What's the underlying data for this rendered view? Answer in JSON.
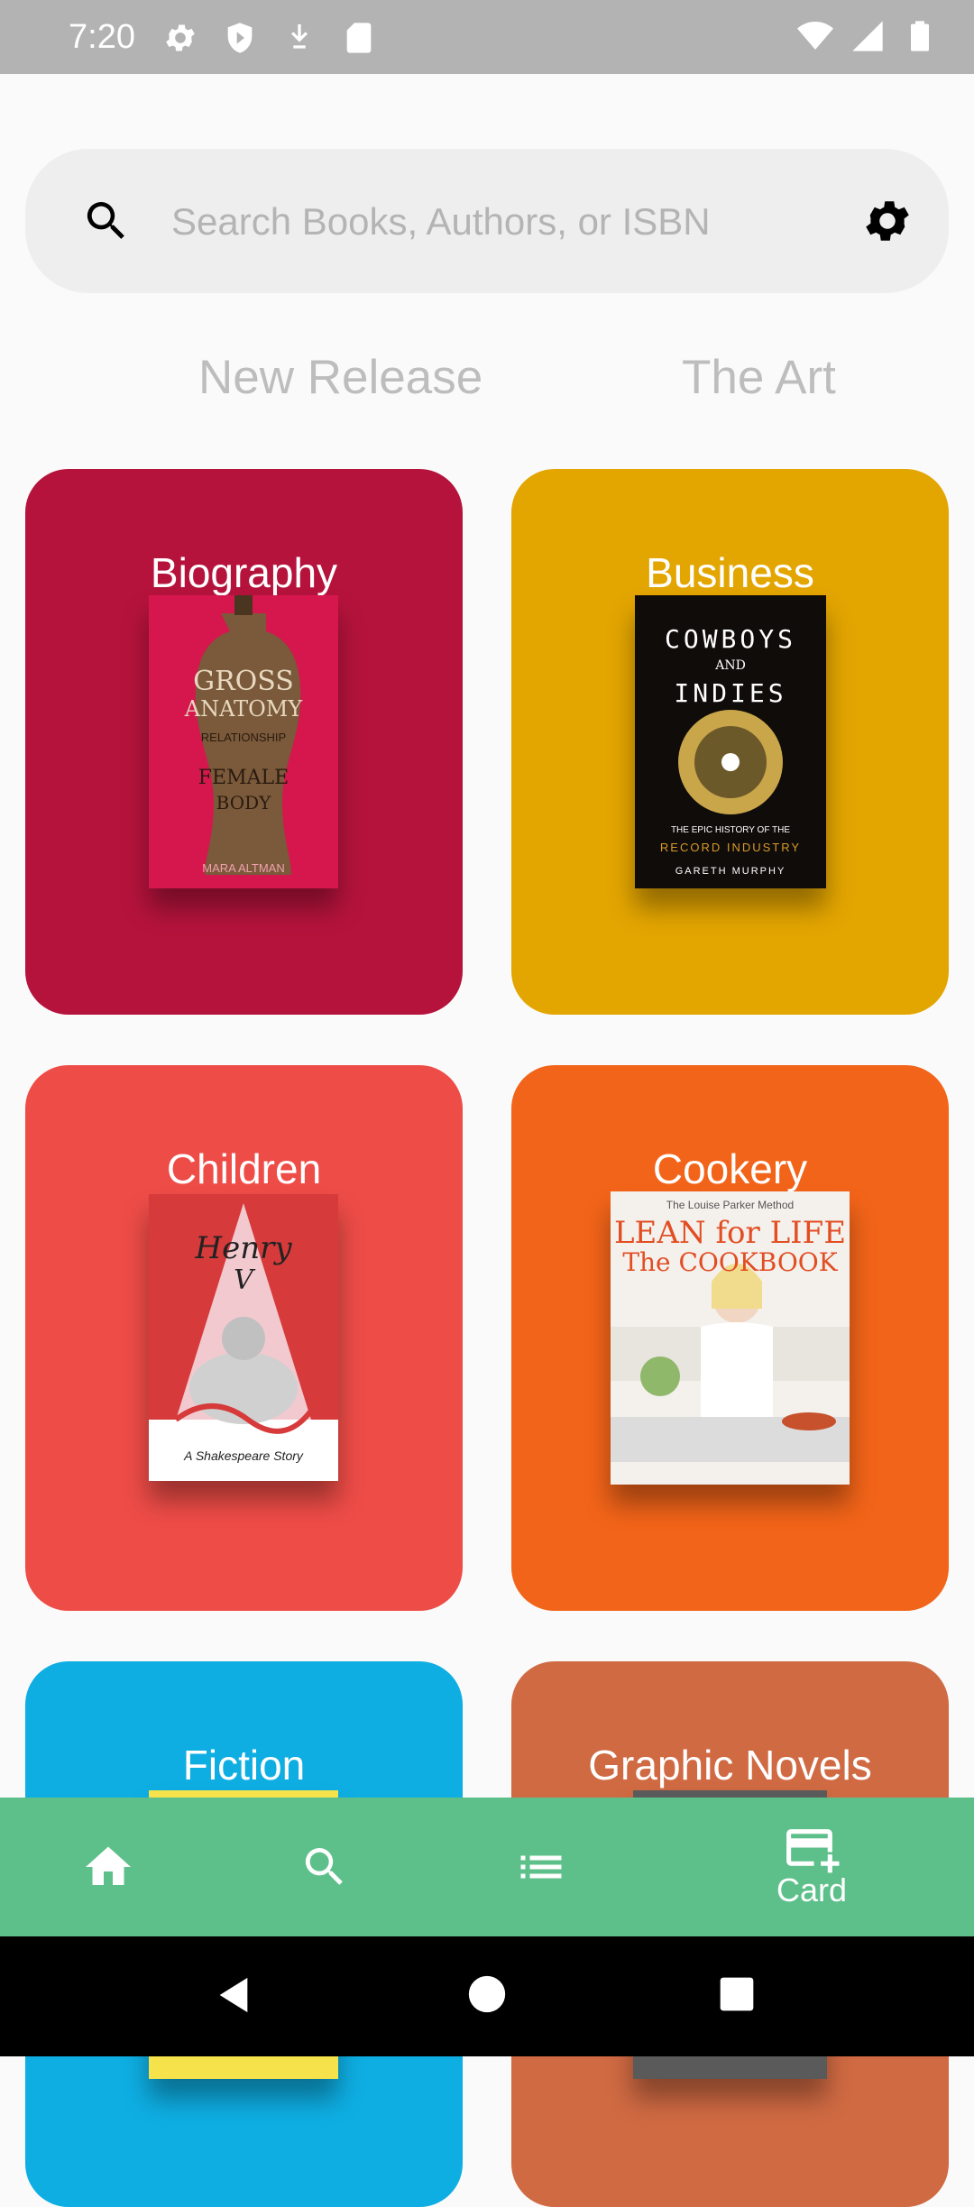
{
  "status_bar": {
    "time": "7:20",
    "left_icons": [
      "settings-icon",
      "shield-icon",
      "download-icon",
      "sd-card-icon"
    ],
    "right_icons": [
      "wifi-icon",
      "signal-icon",
      "battery-icon"
    ]
  },
  "search": {
    "placeholder": "Search Books, Authors, or ISBN",
    "value": ""
  },
  "tabs": [
    {
      "label": "New Release"
    },
    {
      "label": "The Art"
    }
  ],
  "categories": [
    {
      "title": "Biography",
      "color": "#b5133c",
      "book": {
        "title_line1": "GROSS",
        "title_line2": "ANATOMY",
        "subtitle": "RELATIONSHIP",
        "subtitle2": "FEMALE",
        "subtitle3": "BODY",
        "author": "MARA ALTMAN"
      }
    },
    {
      "title": "Business",
      "color": "#e3a500",
      "book": {
        "title_line1": "COWBOYS",
        "title_line2": "AND",
        "subtitle": "INDIES",
        "subtitle2": "THE EPIC HISTORY OF THE",
        "subtitle3": "RECORD INDUSTRY",
        "author": "GARETH MURPHY"
      }
    },
    {
      "title": "Children",
      "color": "#ee4c47",
      "book": {
        "title_line1": "Henry",
        "title_line2": "V",
        "subtitle": "A Shakespeare Story",
        "author": ""
      }
    },
    {
      "title": "Cookery",
      "color": "#f26419",
      "book": {
        "title_line1": "LEAN for LIFE",
        "title_line2": "The COOKBOOK",
        "subtitle": "The Louise Parker Method",
        "author": ""
      }
    },
    {
      "title": "Fiction",
      "color": "#0eaee3"
    },
    {
      "title": "Graphic Novels",
      "color": "#d06a43"
    }
  ],
  "bottom_nav": {
    "items": [
      {
        "icon": "home-icon",
        "label": ""
      },
      {
        "icon": "search-icon",
        "label": ""
      },
      {
        "icon": "list-icon",
        "label": ""
      },
      {
        "icon": "add-card-icon",
        "label": "Card"
      }
    ],
    "color": "#5dc08a"
  }
}
